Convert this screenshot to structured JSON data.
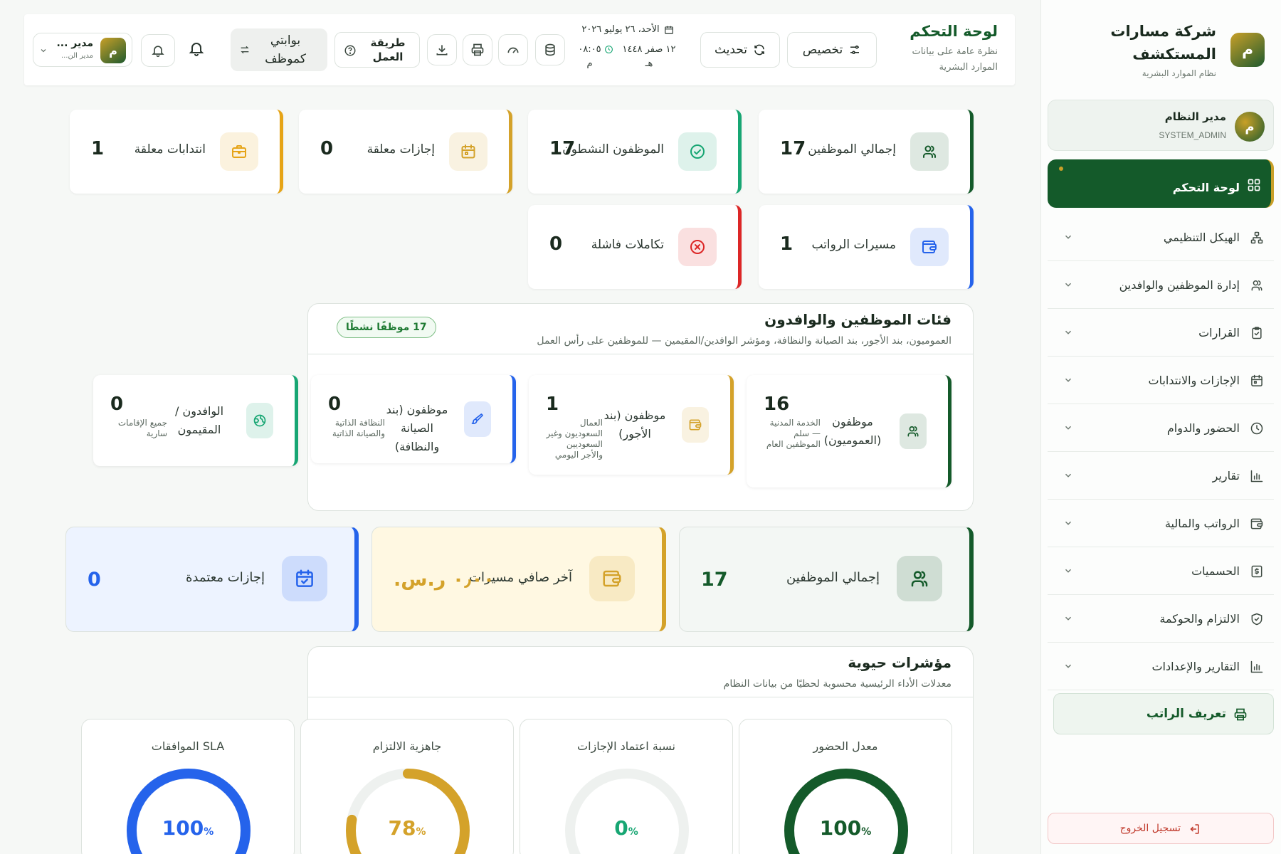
{
  "sidebar": {
    "brand_name": "شركة مسارات المستكشف",
    "brand_sub": "نظام الموارد البشرية",
    "brand_logo_letter": "م",
    "user": {
      "avatar_letter": "م",
      "name": "مدير النظام",
      "role": "SYSTEM_ADMIN"
    },
    "active_item": {
      "label": "لوحة التحكم",
      "icon": "dashboard-grid-icon"
    },
    "items": [
      {
        "label": "الهيكل التنظيمي",
        "icon": "org-structure-icon"
      },
      {
        "label": "إدارة الموظفين والوافدين",
        "icon": "users-icon"
      },
      {
        "label": "القرارات",
        "icon": "clipboard-icon"
      },
      {
        "label": "الإجازات والانتدابات",
        "icon": "calendar-icon"
      },
      {
        "label": "الحضور والدوام",
        "icon": "clock-icon"
      },
      {
        "label": "تقارير",
        "icon": "bar-chart-icon"
      },
      {
        "label": "الرواتب والمالية",
        "icon": "wallet-icon"
      },
      {
        "label": "الحسميات",
        "icon": "dollar-receipt-icon"
      },
      {
        "label": "الالتزام والحوكمة",
        "icon": "shield-check-icon"
      },
      {
        "label": "التقارير والإعدادات",
        "icon": "bar-chart-icon"
      }
    ],
    "payslip_label": "تعريف الراتب",
    "logout_label": "تسجيل الخروج"
  },
  "topbar": {
    "title": "لوحة التحكم",
    "subtitle": "نظرة عامة على بيانات الموارد البشرية",
    "customize_label": "تخصيص",
    "refresh_label": "تحديث",
    "date_gregorian": "الأحد، ٢٦ يوليو ٢٠٢٦",
    "date_hijri": "١٢ صفر ١٤٤٨ هـ",
    "time": "٠٨:٠٥ م",
    "work_mode_label": "طريقة العمل",
    "portal_label": "بوابتي كموظف",
    "admin_avatar_letter": "م",
    "admin_name": "مدير ...",
    "admin_role": "مدير الن..."
  },
  "stats": [
    {
      "label": "إجمالي الموظفين",
      "value": "17",
      "icon": "users-icon",
      "accent": "#145a2a"
    },
    {
      "label": "الموظفون النشطون",
      "value": "17",
      "icon": "check-circle-icon",
      "accent": "#17a673"
    },
    {
      "label": "إجازات معلقة",
      "value": "0",
      "icon": "calendar-icon",
      "accent": "#d4a22a"
    },
    {
      "label": "انتدابات معلقة",
      "value": "1",
      "icon": "briefcase-icon",
      "accent": "#e6a417"
    },
    {
      "label": "مسيرات الرواتب",
      "value": "1",
      "icon": "wallet-icon",
      "accent": "#2563eb"
    },
    {
      "label": "تكاملات فاشلة",
      "value": "0",
      "icon": "x-circle-icon",
      "accent": "#dc2626"
    }
  ],
  "categories": {
    "title": "فئات الموظفين والوافدون",
    "subtitle": "العموميون، بند الأجور، بند الصيانة والنظافة، ومؤشر الوافدين/المقيمين — للموظفين على رأس العمل",
    "badge": "17 موظفًا نشطًا",
    "items": [
      {
        "label": "موظفون (العموميون)",
        "value": "16",
        "note": "الخدمة المدنية — سلم الموظفين العام",
        "icon": "users-icon",
        "accent": "#145a2a"
      },
      {
        "label": "موظفون (بند الأجور)",
        "value": "1",
        "note": "العمال السعوديون وغير السعوديين والأجر اليومي",
        "icon": "wallet-icon",
        "accent": "#d4a22a"
      },
      {
        "label": "موظفون (بند الصيانة والنظافة)",
        "value": "0",
        "note": "النظافة الذاتية والصيانة الذاتية",
        "icon": "brush-icon",
        "accent": "#2563eb"
      },
      {
        "label": "الوافدون / المقيمون",
        "value": "0",
        "note": "جميع الإقامات سارية",
        "icon": "globe-icon",
        "accent": "#17a673"
      }
    ]
  },
  "summary": [
    {
      "label": "إجمالي الموظفين",
      "value": "17",
      "icon": "users-icon",
      "accent": "#145a2a"
    },
    {
      "label": "آخر صافي مسيرات",
      "value": "٠٫٠٠ ر.س.",
      "icon": "wallet-icon",
      "accent": "#d4a22a"
    },
    {
      "label": "إجازات معتمدة",
      "value": "0",
      "icon": "calendar-check-icon",
      "accent": "#2563eb"
    }
  ],
  "vitals": {
    "title": "مؤشرات حيوية",
    "subtitle": "معدلات الأداء الرئيسية محسوبة لحظيًا من بيانات النظام",
    "items": [
      {
        "label": "معدل الحضور",
        "value": "100",
        "unit": "%",
        "percent": 100,
        "color": "#145a2a"
      },
      {
        "label": "نسبة اعتماد الإجازات",
        "value": "0",
        "unit": "%",
        "percent": 0,
        "color": "#17a673"
      },
      {
        "label": "جاهزية الالتزام",
        "value": "78",
        "unit": "%",
        "percent": 78,
        "color": "#d4a22a"
      },
      {
        "label": "SLA الموافقات",
        "value": "100",
        "unit": "%",
        "percent": 100,
        "color": "#2563eb"
      }
    ]
  }
}
